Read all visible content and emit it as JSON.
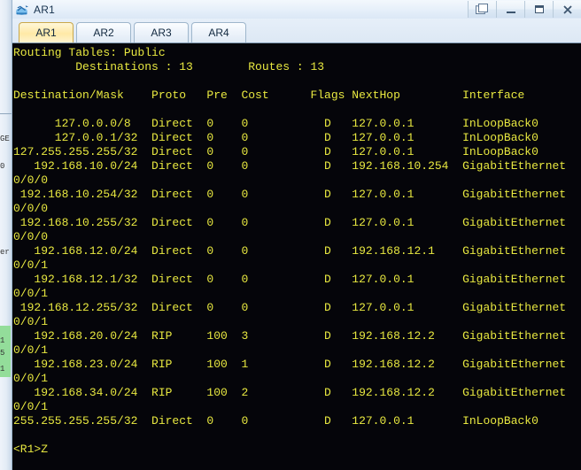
{
  "window": {
    "title": "AR1",
    "icon": "router-icon",
    "controls": [
      {
        "name": "restore-window-button",
        "glyph": "restore-icon"
      },
      {
        "name": "minimize-window-button",
        "glyph": "minimize-icon"
      },
      {
        "name": "maximize-window-button",
        "glyph": "maximize-icon"
      },
      {
        "name": "close-window-button",
        "glyph": "close-icon"
      }
    ]
  },
  "tabs": [
    {
      "label": "AR1",
      "active": true
    },
    {
      "label": "AR2",
      "active": false
    },
    {
      "label": "AR3",
      "active": false
    },
    {
      "label": "AR4",
      "active": false
    }
  ],
  "terminal": {
    "foreground_color": "#e8e840",
    "background_color": "#05050a",
    "prompt": "<R1>Z",
    "header": {
      "routing_table_label": "Routing Tables: Public",
      "destinations_label": "Destinations",
      "destinations_count": "13",
      "routes_label": "Routes",
      "routes_count": "13"
    },
    "columns": [
      "Destination/Mask",
      "Proto",
      "Pre",
      "Cost",
      "Flags",
      "NextHop",
      "Interface"
    ],
    "lines": [
      "Routing Tables: Public",
      "         Destinations : 13        Routes : 13",
      "",
      "Destination/Mask    Proto   Pre  Cost      Flags NextHop         Interface",
      "",
      "      127.0.0.0/8   Direct  0    0           D   127.0.0.1       InLoopBack0",
      "      127.0.0.1/32  Direct  0    0           D   127.0.0.1       InLoopBack0",
      "127.255.255.255/32  Direct  0    0           D   127.0.0.1       InLoopBack0",
      "   192.168.10.0/24  Direct  0    0           D   192.168.10.254  GigabitEthernet",
      "0/0/0",
      " 192.168.10.254/32  Direct  0    0           D   127.0.0.1       GigabitEthernet",
      "0/0/0",
      " 192.168.10.255/32  Direct  0    0           D   127.0.0.1       GigabitEthernet",
      "0/0/0",
      "   192.168.12.0/24  Direct  0    0           D   192.168.12.1    GigabitEthernet",
      "0/0/1",
      "   192.168.12.1/32  Direct  0    0           D   127.0.0.1       GigabitEthernet",
      "0/0/1",
      " 192.168.12.255/32  Direct  0    0           D   127.0.0.1       GigabitEthernet",
      "0/0/1",
      "   192.168.20.0/24  RIP     100  3           D   192.168.12.2    GigabitEthernet",
      "0/0/1",
      "   192.168.23.0/24  RIP     100  1           D   192.168.12.2    GigabitEthernet",
      "0/0/1",
      "   192.168.34.0/24  RIP     100  2           D   192.168.12.2    GigabitEthernet",
      "0/0/1",
      "255.255.255.255/32  Direct  0    0           D   127.0.0.1       InLoopBack0",
      "",
      "<R1>Z"
    ],
    "routes": [
      {
        "destination": "127.0.0.0/8",
        "proto": "Direct",
        "pre": "0",
        "cost": "0",
        "flags": "D",
        "nexthop": "127.0.0.1",
        "interface": "InLoopBack0"
      },
      {
        "destination": "127.0.0.1/32",
        "proto": "Direct",
        "pre": "0",
        "cost": "0",
        "flags": "D",
        "nexthop": "127.0.0.1",
        "interface": "InLoopBack0"
      },
      {
        "destination": "127.255.255.255/32",
        "proto": "Direct",
        "pre": "0",
        "cost": "0",
        "flags": "D",
        "nexthop": "127.0.0.1",
        "interface": "InLoopBack0"
      },
      {
        "destination": "192.168.10.0/24",
        "proto": "Direct",
        "pre": "0",
        "cost": "0",
        "flags": "D",
        "nexthop": "192.168.10.254",
        "interface": "GigabitEthernet0/0/0"
      },
      {
        "destination": "192.168.10.254/32",
        "proto": "Direct",
        "pre": "0",
        "cost": "0",
        "flags": "D",
        "nexthop": "127.0.0.1",
        "interface": "GigabitEthernet0/0/0"
      },
      {
        "destination": "192.168.10.255/32",
        "proto": "Direct",
        "pre": "0",
        "cost": "0",
        "flags": "D",
        "nexthop": "127.0.0.1",
        "interface": "GigabitEthernet0/0/0"
      },
      {
        "destination": "192.168.12.0/24",
        "proto": "Direct",
        "pre": "0",
        "cost": "0",
        "flags": "D",
        "nexthop": "192.168.12.1",
        "interface": "GigabitEthernet0/0/1"
      },
      {
        "destination": "192.168.12.1/32",
        "proto": "Direct",
        "pre": "0",
        "cost": "0",
        "flags": "D",
        "nexthop": "127.0.0.1",
        "interface": "GigabitEthernet0/0/1"
      },
      {
        "destination": "192.168.12.255/32",
        "proto": "Direct",
        "pre": "0",
        "cost": "0",
        "flags": "D",
        "nexthop": "127.0.0.1",
        "interface": "GigabitEthernet0/0/1"
      },
      {
        "destination": "192.168.20.0/24",
        "proto": "RIP",
        "pre": "100",
        "cost": "3",
        "flags": "D",
        "nexthop": "192.168.12.2",
        "interface": "GigabitEthernet0/0/1"
      },
      {
        "destination": "192.168.23.0/24",
        "proto": "RIP",
        "pre": "100",
        "cost": "1",
        "flags": "D",
        "nexthop": "192.168.12.2",
        "interface": "GigabitEthernet0/0/1"
      },
      {
        "destination": "192.168.34.0/24",
        "proto": "RIP",
        "pre": "100",
        "cost": "2",
        "flags": "D",
        "nexthop": "192.168.12.2",
        "interface": "GigabitEthernet0/0/1"
      },
      {
        "destination": "255.255.255.255/32",
        "proto": "Direct",
        "pre": "0",
        "cost": "0",
        "flags": "D",
        "nexthop": "127.0.0.1",
        "interface": "InLoopBack0"
      }
    ]
  },
  "background_strip": {
    "fragments": [
      "GE",
      "0",
      "er",
      "1",
      "5",
      "1"
    ]
  }
}
